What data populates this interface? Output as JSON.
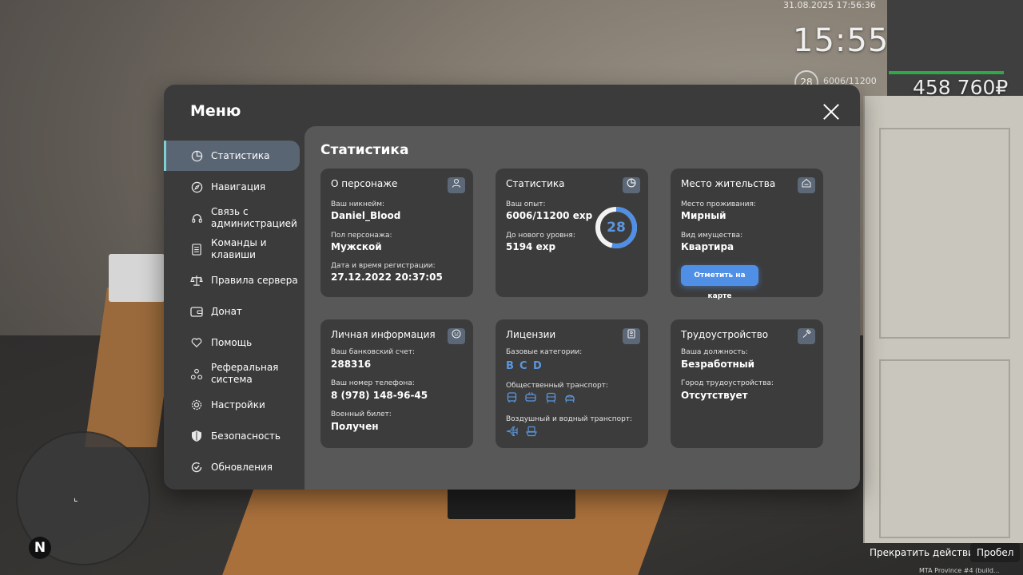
{
  "hud": {
    "date": "31.08.2025 17:56:36",
    "time": "15:55",
    "level": "28",
    "exp": "6006/11200",
    "money": "458 760₽",
    "action_hint": "Прекратить действие",
    "action_key": "Пробел",
    "build": "MTA Province #4 (build..."
  },
  "menu": {
    "title": "Меню",
    "sidebar": [
      {
        "label": "Статистика",
        "icon": "pie-chart-icon"
      },
      {
        "label": "Навигация",
        "icon": "compass-icon"
      },
      {
        "label": "Связь с администрацией",
        "icon": "headset-icon"
      },
      {
        "label": "Команды и клавиши",
        "icon": "list-icon"
      },
      {
        "label": "Правила сервера",
        "icon": "scales-icon"
      },
      {
        "label": "Донат",
        "icon": "wallet-icon"
      },
      {
        "label": "Помощь",
        "icon": "heart-hand-icon"
      },
      {
        "label": "Реферальная система",
        "icon": "referral-icon"
      },
      {
        "label": "Настройки",
        "icon": "gear-icon"
      },
      {
        "label": "Безопасность",
        "icon": "shield-icon"
      },
      {
        "label": "Обновления",
        "icon": "refresh-icon"
      }
    ],
    "content_title": "Статистика",
    "cards": {
      "character": {
        "title": "О персонаже",
        "nickname_label": "Ваш никнейм:",
        "nickname": "Daniel_Blood",
        "gender_label": "Пол персонажа:",
        "gender": "Мужской",
        "reg_label": "Дата и время регистрации:",
        "reg": "27.12.2022 20:37:05"
      },
      "stats": {
        "title": "Статистика",
        "exp_label": "Ваш опыт:",
        "exp": "6006/11200 exp",
        "next_label": "До нового уровня:",
        "next": "5194 exp",
        "level": "28",
        "level_progress": 0.536
      },
      "residence": {
        "title": "Место жительства",
        "place_label": "Место проживания:",
        "place": "Мирный",
        "property_label": "Вид имущества:",
        "property": "Квартира",
        "button": "Отметить на карте"
      },
      "personal": {
        "title": "Личная информация",
        "bank_label": "Ваш банковский счет:",
        "bank": "288316",
        "phone_label": "Ваш номер телефона:",
        "phone": "8 (978) 148-96-45",
        "military_label": "Военный билет:",
        "military": "Получен"
      },
      "licenses": {
        "title": "Лицензии",
        "basic_label": "Базовые категории:",
        "categories": [
          "B",
          "C",
          "D"
        ],
        "public_label": "Общественный транспорт:",
        "public_icons": [
          "bus-icon",
          "trolleybus-icon",
          "tram-icon",
          "train-icon"
        ],
        "air_label": "Воздушный и водный транспорт:",
        "air_icons": [
          "plane-icon",
          "ship-icon"
        ]
      },
      "employment": {
        "title": "Трудоустройство",
        "position_label": "Ваша должность:",
        "position": "Безработный",
        "city_label": "Город трудоустройства:",
        "city": "Отсутствует"
      }
    }
  },
  "colors": {
    "accent": "#4f8fe6",
    "active_nav": "#5a6574",
    "card_bg": "#3c3c3c",
    "content_bg": "#585858",
    "menu_bg": "#3b3b3b",
    "exp_bar": "#2fa84a"
  }
}
